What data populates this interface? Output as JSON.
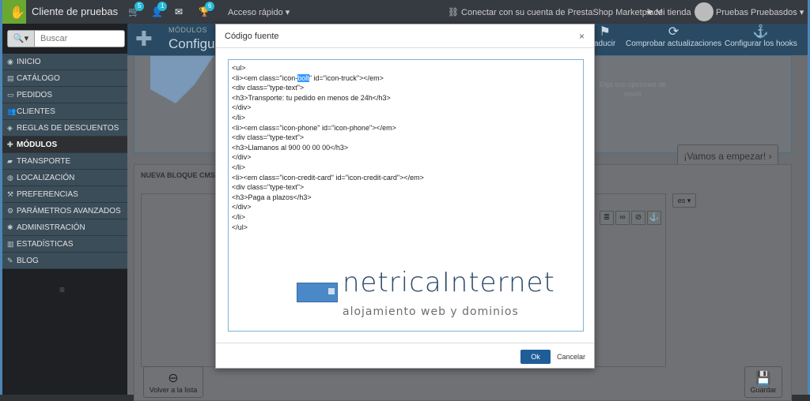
{
  "topbar": {
    "shop_name": "Cliente de pruebas",
    "orders_badge": "5",
    "customers_badge": "1",
    "trophy_badge": "6",
    "quick_access": "Acceso rápido ▾",
    "connect": "Conectar con su cuenta de PrestaShop Marketplace",
    "my_store": "Mi tienda",
    "user": "Pruebas Pruebasdos ▾"
  },
  "sidebar": {
    "search_placeholder": "Buscar",
    "items": [
      {
        "label": "INICIO"
      },
      {
        "label": "CATÁLOGO"
      },
      {
        "label": "PEDIDOS"
      },
      {
        "label": "CLIENTES"
      },
      {
        "label": "REGLAS DE DESCUENTOS"
      },
      {
        "label": "MÓDULOS"
      },
      {
        "label": "TRANSPORTE"
      },
      {
        "label": "LOCALIZACIÓN"
      },
      {
        "label": "PREFERENCIAS"
      },
      {
        "label": "PARÁMETROS AVANZADOS"
      },
      {
        "label": "ADMINISTRACIÓN"
      },
      {
        "label": "ESTADÍSTICAS"
      },
      {
        "label": "BLOG"
      }
    ]
  },
  "header": {
    "breadcrumb": "MÓDULOS",
    "title": "Configur",
    "translate": "aducir",
    "check_updates": "Comprobar actualizaciones",
    "configure_hooks": "Configurar los hooks"
  },
  "panel1": {
    "shipping_text": "Elija sus opciones de envío",
    "start_button": "¡Vamos a empezar! ›"
  },
  "panel2": {
    "title": "NUEVA BLOQUE CMS PE",
    "lang": "es ▾",
    "back": "Volver a la lista",
    "save": "Guardar"
  },
  "modal": {
    "title": "Código fuente",
    "code_lines": [
      "<ul>",
      "<li><em class=\"icon-",
      "bolt",
      "\" id=\"icon-truck\"></em>",
      "<div class=\"type-text\">",
      "<h3>Transporte: tu pedido en menos de 24h</h3>",
      "</div>",
      "</li>",
      "<li><em class=\"icon-phone\" id=\"icon-phone\"></em>",
      "<div class=\"type-text\">",
      "<h3>Llamanos al 900 00 00 00</h3>",
      "</div>",
      "</li>",
      "<li><em class=\"icon-credit-card\" id=\"icon-credit-card\"></em>",
      "<div class=\"type-text\">",
      "<h3>Paga a plazos</h3>",
      "</div>",
      "</li>",
      "</ul>"
    ],
    "ok": "Ok",
    "cancel": "Cancelar"
  },
  "watermark": {
    "name": "netricaInternet",
    "tagline": "alojamiento web y dominios"
  },
  "colors": {
    "accent": "#25b9d7",
    "ok_button": "#1f5d99",
    "logo_green": "#6ba832"
  }
}
